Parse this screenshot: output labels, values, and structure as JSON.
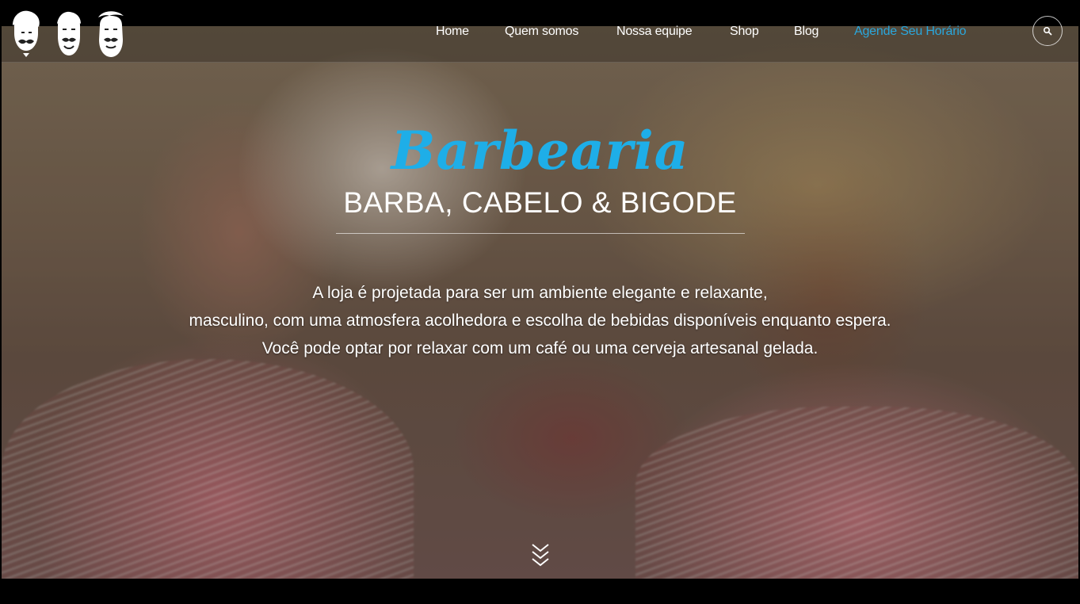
{
  "header": {
    "logo_icons": [
      "mustache-man-icon",
      "beard-man-icon",
      "full-beard-man-icon"
    ],
    "nav": [
      {
        "label": "Home"
      },
      {
        "label": "Quem somos"
      },
      {
        "label": "Nossa equipe"
      },
      {
        "label": "Shop"
      },
      {
        "label": "Blog"
      },
      {
        "label": "Agende Seu Horário"
      }
    ],
    "search_icon": "search-icon",
    "accent_color": "#2aa7dd"
  },
  "hero": {
    "brand": "Barbearia",
    "tagline": "BARBA, CABELO & BIGODE",
    "description": [
      "A loja é projetada para ser um ambiente elegante e relaxante,",
      "masculino, com uma atmosfera acolhedora e escolha de bebidas disponíveis enquanto espera.",
      "Você pode optar por relaxar com um café ou uma cerveja artesanal gelada."
    ],
    "scroll_icon": "chevrons-down-icon",
    "brand_color": "#1eaee8"
  }
}
